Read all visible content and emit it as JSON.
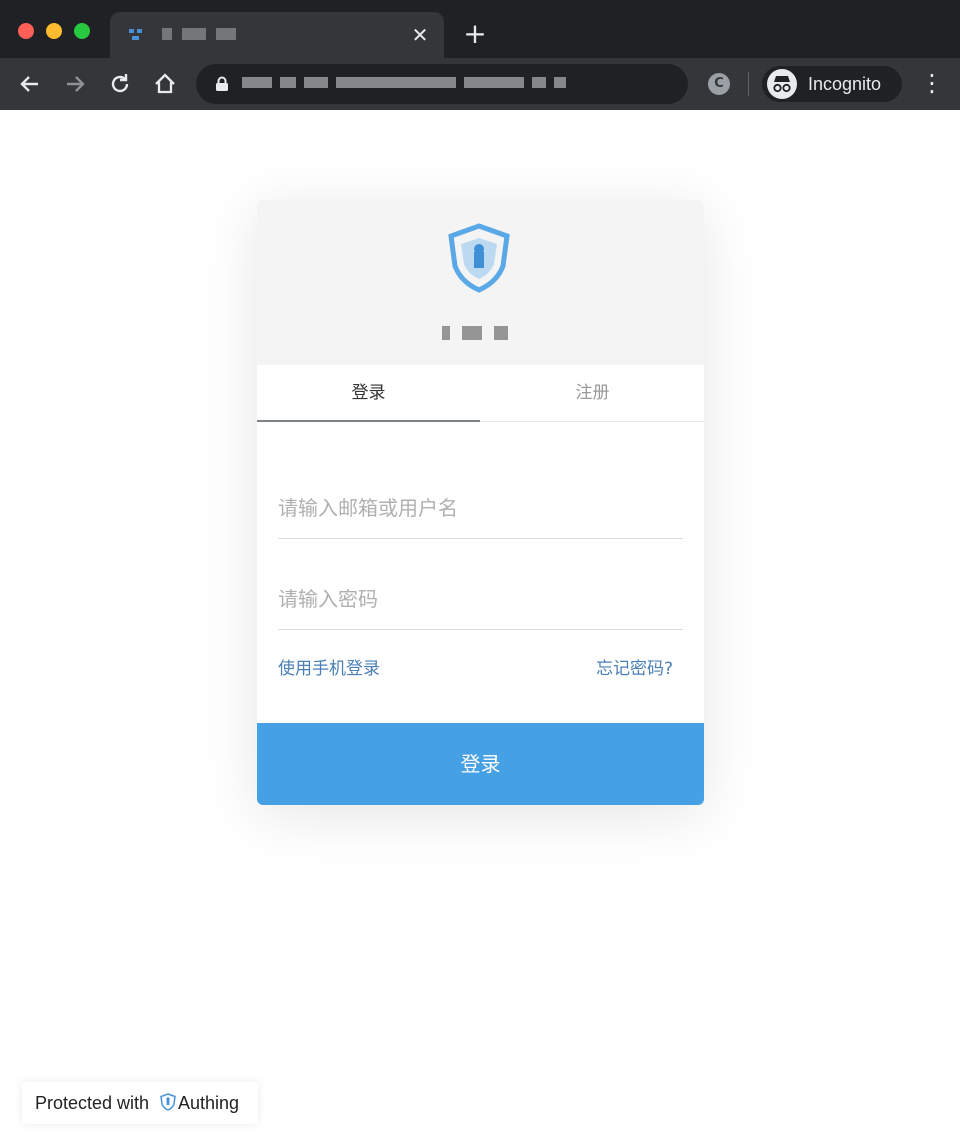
{
  "browser": {
    "new_tab": "+",
    "close_tab": "✕",
    "extension_letter": "C",
    "incognito_label": "Incognito",
    "menu": "⋮"
  },
  "login_card": {
    "tabs": [
      {
        "label": "登录",
        "active": true
      },
      {
        "label": "注册",
        "active": false
      }
    ],
    "username_placeholder": "请输入邮箱或用户名",
    "password_placeholder": "请输入密码",
    "phone_login_link": "使用手机登录",
    "forgot_password_link": "忘记密码?",
    "submit_label": "登录"
  },
  "badge": {
    "prefix": "Protected with",
    "brand": "Authing"
  },
  "colors": {
    "primary": "#46a0e4",
    "link": "#4a7fb5",
    "header_bg": "#f4f4f4"
  }
}
